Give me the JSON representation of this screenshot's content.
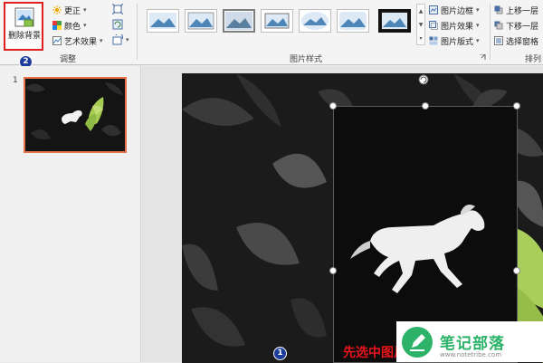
{
  "ribbon": {
    "remove_bg_label": "删除背景",
    "adjust_items": [
      {
        "label": "更正",
        "icon": "sun-icon"
      },
      {
        "label": "颜色",
        "icon": "palette-icon"
      },
      {
        "label": "艺术效果",
        "icon": "art-effects-icon"
      }
    ],
    "adjust_group_label": "调整",
    "styles_group_label": "图片样式",
    "style_items": [
      {
        "label": "图片边框",
        "icon": "picture-border-icon"
      },
      {
        "label": "图片效果",
        "icon": "picture-effects-icon"
      },
      {
        "label": "图片版式",
        "icon": "picture-layout-icon"
      }
    ],
    "arrange_items": [
      {
        "label": "上移一层",
        "icon": "bring-forward-icon"
      },
      {
        "label": "下移一层",
        "icon": "send-backward-icon"
      },
      {
        "label": "选择窗格",
        "icon": "selection-pane-icon"
      }
    ],
    "arrange_group_label": "排列",
    "callout_2": "2"
  },
  "slides_panel": {
    "slide_number": "1"
  },
  "canvas": {
    "callout_1": "1",
    "caption": "先选中图片"
  },
  "watermark": {
    "text": "笔记部落",
    "url": "www.notetribe.com",
    "brand_color": "#2db369"
  }
}
